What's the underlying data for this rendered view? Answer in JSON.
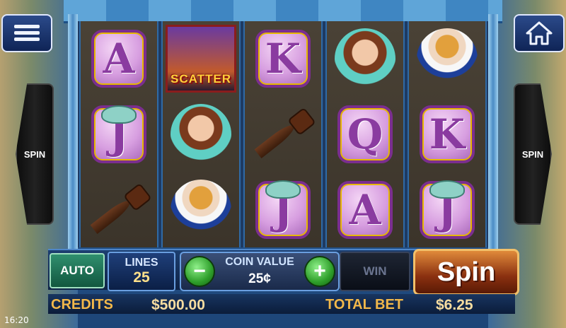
{
  "game": {
    "reels": [
      [
        {
          "type": "letter",
          "label": "A"
        },
        {
          "type": "letter",
          "label": "J"
        },
        {
          "type": "dagger",
          "label": ""
        }
      ],
      [
        {
          "type": "scatter",
          "label": "SCATTER"
        },
        {
          "type": "genie",
          "label": ""
        },
        {
          "type": "sultan",
          "label": ""
        }
      ],
      [
        {
          "type": "letter",
          "label": "K"
        },
        {
          "type": "dagger",
          "label": ""
        },
        {
          "type": "letter",
          "label": "J"
        }
      ],
      [
        {
          "type": "genie",
          "label": ""
        },
        {
          "type": "letter",
          "label": "Q"
        },
        {
          "type": "letter",
          "label": "A"
        }
      ],
      [
        {
          "type": "sultan",
          "label": ""
        },
        {
          "type": "letter",
          "label": "K"
        },
        {
          "type": "letter",
          "label": "J"
        }
      ]
    ]
  },
  "side": {
    "left_label": "SPIN",
    "right_label": "SPIN"
  },
  "controls": {
    "auto_label": "AUTO",
    "lines_label": "LINES",
    "lines_value": "25",
    "coin_label": "COIN VALUE",
    "coin_value": "25¢",
    "minus_label": "−",
    "plus_label": "+",
    "win_label": "WIN",
    "spin_label": "Spin"
  },
  "status": {
    "credits_label": "CREDITS",
    "credits_value": "$500.00",
    "total_bet_label": "TOTAL BET",
    "total_bet_value": "$6.25",
    "clock": "16:20"
  },
  "icons": {
    "menu": "hamburger-menu-icon",
    "home": "home-icon"
  }
}
